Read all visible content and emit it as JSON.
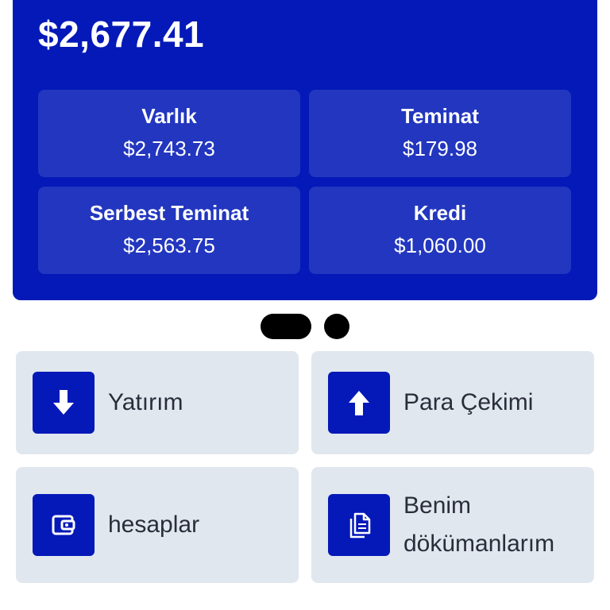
{
  "balance": {
    "total": "$2,677.41"
  },
  "stats": {
    "assets": {
      "label": "Varlık",
      "value": "$2,743.73"
    },
    "margin": {
      "label": "Teminat",
      "value": "$179.98"
    },
    "free_margin": {
      "label": "Serbest Teminat",
      "value": "$2,563.75"
    },
    "credit": {
      "label": "Kredi",
      "value": "$1,060.00"
    }
  },
  "pager": {
    "count": 2,
    "active_index": 0
  },
  "actions": {
    "deposit": {
      "label": "Yatırım",
      "icon": "arrow-down-icon"
    },
    "withdraw": {
      "label": "Para Çekimi",
      "icon": "arrow-up-icon"
    },
    "accounts": {
      "label": "hesaplar",
      "icon": "wallet-icon"
    },
    "documents": {
      "label": "Benim dökümanlarım",
      "icon": "documents-icon"
    }
  },
  "colors": {
    "brand": "#0419b8",
    "stat_box": "#2236bf",
    "tile_bg": "#e1e7ef",
    "text_dark": "#2a2d3a"
  }
}
